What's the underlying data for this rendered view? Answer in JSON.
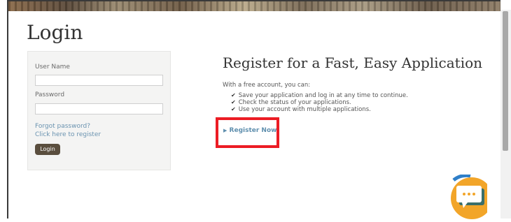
{
  "page": {
    "title": "Login"
  },
  "login": {
    "username_label": "User Name",
    "username_value": "",
    "password_label": "Password",
    "password_value": "",
    "forgot_link": "Forgot password?",
    "register_link": "Click here to register",
    "login_button": "Login"
  },
  "register": {
    "title": "Register for a Fast, Easy Application",
    "intro": "With a free account, you can:",
    "benefits": [
      "Save your application and log in at any time to continue.",
      "Check the status of your applications.",
      "Use your account with multiple applications."
    ],
    "cta": "Register Now"
  },
  "icons": {
    "checkmark": "check-icon",
    "cta_arrow": "caret-right-icon",
    "chat": "chat-icon"
  },
  "colors": {
    "accent_link": "#6a93b0",
    "cta": "#5f8fae",
    "login_button": "#5a4e3e",
    "highlight": "#ec1c24",
    "chat_bg": "#f2a529",
    "chat_bubble": "#2f7fc8"
  }
}
